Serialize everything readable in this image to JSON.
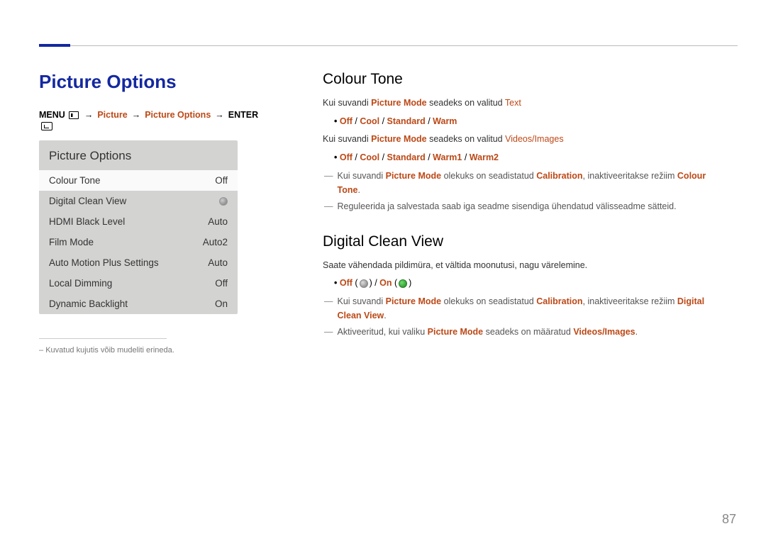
{
  "page_number": "87",
  "left": {
    "heading": "Picture Options",
    "breadcrumb": {
      "menu": "MENU",
      "picture": "Picture",
      "picture_options": "Picture Options",
      "enter": "ENTER"
    },
    "panel": {
      "title": "Picture Options",
      "rows": [
        {
          "label": "Colour Tone",
          "value": "Off",
          "selected": true
        },
        {
          "label": "Digital Clean View",
          "value_icon": "circle"
        },
        {
          "label": "HDMI Black Level",
          "value": "Auto"
        },
        {
          "label": "Film Mode",
          "value": "Auto2"
        },
        {
          "label": "Auto Motion Plus Settings",
          "value": "Auto"
        },
        {
          "label": "Local Dimming",
          "value": "Off"
        },
        {
          "label": "Dynamic Backlight",
          "value": "On"
        }
      ]
    },
    "footnote_prefix": "– ",
    "footnote": "Kuvatud kujutis võib mudeliti erineda."
  },
  "right": {
    "colour_tone": {
      "heading": "Colour Tone",
      "line1_pre": "Kui suvandi ",
      "line1_hl": "Picture Mode",
      "line1_mid": " seadeks on valitud ",
      "line1_end": "Text",
      "opts1": {
        "off": "Off",
        "cool": "Cool",
        "std": "Standard",
        "warm": "Warm",
        "sep": " / "
      },
      "line2_pre": "Kui suvandi ",
      "line2_hl": "Picture Mode",
      "line2_mid": " seadeks on valitud ",
      "line2_end": "Videos/Images",
      "opts2": {
        "off": "Off",
        "cool": "Cool",
        "std": "Standard",
        "w1": "Warm1",
        "w2": "Warm2",
        "sep": " / "
      },
      "dash1_pre": "Kui suvandi ",
      "dash1_h1": "Picture Mode",
      "dash1_mid": " olekuks on seadistatud ",
      "dash1_h2": "Calibration",
      "dash1_mid2": ", inaktiveeritakse režiim ",
      "dash1_h3": "Colour Tone",
      "dash1_dot": ".",
      "dash2": "Reguleerida ja salvestada saab iga seadme sisendiga ühendatud välisseadme sätteid."
    },
    "dcv": {
      "heading": "Digital Clean View",
      "para": "Saate vähendada pildimüra, et vältida moonutusi, nagu värelemine.",
      "opts": {
        "off": "Off",
        "on": "On",
        "sep": " / ",
        "open": " (",
        "close": ") "
      },
      "dash1_pre": "Kui suvandi ",
      "dash1_h1": "Picture Mode",
      "dash1_mid": " olekuks on seadistatud ",
      "dash1_h2": "Calibration",
      "dash1_mid2": ", inaktiveeritakse režiim ",
      "dash1_h3": "Digital Clean View",
      "dash1_dot": ".",
      "dash2_pre": "Aktiveeritud, kui valiku ",
      "dash2_h1": "Picture Mode",
      "dash2_mid": " seadeks on määratud ",
      "dash2_h2": "Videos/Images",
      "dash2_dot": "."
    }
  }
}
